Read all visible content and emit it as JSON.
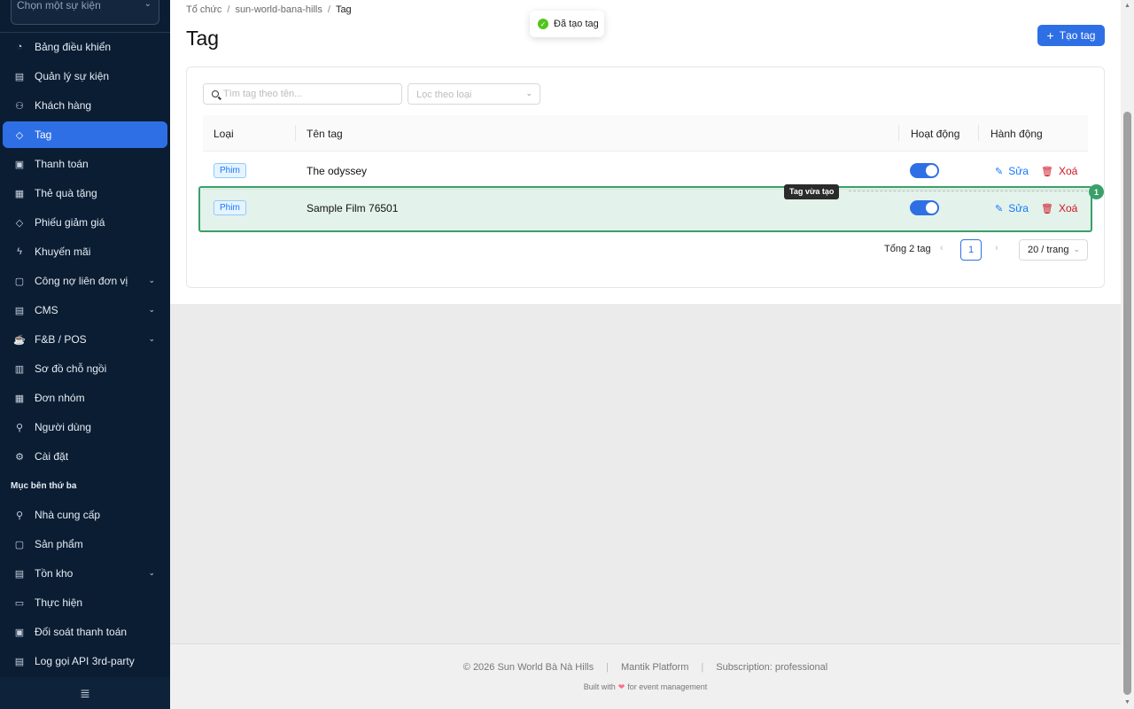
{
  "sidebar": {
    "event_select_placeholder": "Chọn một sự kiện",
    "items": [
      {
        "label": "Bảng điều khiển",
        "icon": "◔"
      },
      {
        "label": "Quản lý sự kiện",
        "icon": "▤"
      },
      {
        "label": "Khách hàng",
        "icon": "⚇"
      },
      {
        "label": "Tag",
        "icon": "◇"
      },
      {
        "label": "Thanh toán",
        "icon": "▣"
      },
      {
        "label": "Thẻ quà tặng",
        "icon": "▦"
      },
      {
        "label": "Phiếu giảm giá",
        "icon": "◇"
      },
      {
        "label": "Khuyến mãi",
        "icon": "ϟ"
      },
      {
        "label": "Công nợ liên đơn vị",
        "icon": "▢"
      },
      {
        "label": "CMS",
        "icon": "▤"
      },
      {
        "label": "F&B / POS",
        "icon": "☕"
      },
      {
        "label": "Sơ đồ chỗ ngồi",
        "icon": "▥"
      },
      {
        "label": "Đơn nhóm",
        "icon": "▦"
      },
      {
        "label": "Người dùng",
        "icon": "⚲"
      },
      {
        "label": "Cài đặt",
        "icon": "⚙"
      }
    ],
    "section_label": "Mục bên thứ ba",
    "third_party_items": [
      {
        "label": "Nhà cung cấp",
        "icon": "⚲"
      },
      {
        "label": "Sản phẩm",
        "icon": "▢"
      },
      {
        "label": "Tồn kho",
        "icon": "▤"
      },
      {
        "label": "Thực hiện",
        "icon": "▭"
      },
      {
        "label": "Đối soát thanh toán",
        "icon": "▣"
      },
      {
        "label": "Log gọi API 3rd-party",
        "icon": "▤"
      }
    ],
    "collapse_icon": "≣"
  },
  "breadcrumb": {
    "items": [
      "Tổ chức",
      "sun-world-bana-hills",
      "Tag"
    ],
    "separator": "/"
  },
  "page": {
    "title": "Tag",
    "add_button": "Tạo tag",
    "add_icon": "+"
  },
  "toast": {
    "message": "Đã tạo tag",
    "icon": "✓"
  },
  "filters": {
    "search_placeholder": "Tìm tag theo tên...",
    "type_placeholder": "Lọc theo loại"
  },
  "table": {
    "columns": [
      "Loại",
      "Tên tag",
      "Hoạt động",
      "Hành động"
    ],
    "rows": [
      {
        "type": "Phim",
        "name": "The odyssey",
        "active": true,
        "edit": "Sửa",
        "delete": "Xoá"
      },
      {
        "type": "Phim",
        "name": "Sample Film 76501",
        "active": true,
        "edit": "Sửa",
        "delete": "Xoá"
      }
    ],
    "edit_icon": "✎",
    "delete_icon": "🗑"
  },
  "highlight": {
    "label": "Tag vừa tạo",
    "number": "1"
  },
  "pagination": {
    "total": "Tổng 2 tag",
    "prev": "‹",
    "current": "1",
    "next": "›",
    "page_size": "20 / trang"
  },
  "footer": {
    "copyright": "© 2026 Sun World Bà Nà Hills",
    "platform": "Mantik Platform",
    "subscription": "Subscription: professional",
    "built_prefix": "Built with",
    "heart": "❤",
    "built_suffix": "for event management",
    "separator": "|"
  },
  "colors": {
    "sidebar_bg": "#0b1d33",
    "accent": "#2f6fe5",
    "highlight": "#3aa06a",
    "delete": "#cf1322"
  }
}
